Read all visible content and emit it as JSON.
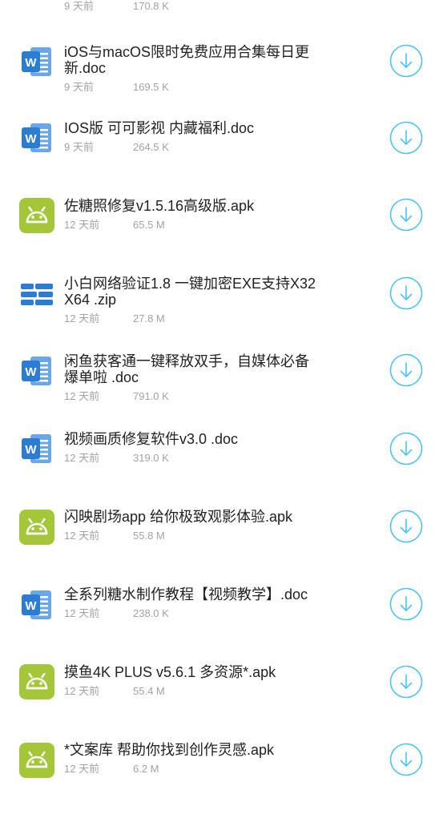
{
  "colors": {
    "title_text": "#222222",
    "meta_text": "#a3a3a3",
    "download_accent": "#4cc3f3",
    "word_icon": "#2b7cd3",
    "android_icon": "#a4c639",
    "compressed_icon": "#2b7cd3"
  },
  "partial_top": {
    "date": "9 天前",
    "size": "170.8 K"
  },
  "files": [
    {
      "icon": "word-icon",
      "title": "iOS与macOS限时免费应用合集每日更新.doc",
      "date": "9 天前",
      "size": "169.5 K"
    },
    {
      "icon": "word-icon",
      "title": "IOS版 可可影视 内藏福利.doc",
      "date": "9 天前",
      "size": "264.5 K"
    },
    {
      "icon": "android-icon",
      "title": "佐糖照修复v1.5.16高级版.apk",
      "date": "12 天前",
      "size": "65.5 M"
    },
    {
      "icon": "archive-icon",
      "title": "小白网络验证1.8 一键加密EXE支持X32 X64 .zip",
      "date": "12 天前",
      "size": "27.8 M"
    },
    {
      "icon": "word-icon",
      "title": "闲鱼获客通一键释放双手，自媒体必备 爆单啦 .doc",
      "date": "12 天前",
      "size": "791.0 K"
    },
    {
      "icon": "word-icon",
      "title": "视频画质修复软件v3.0 .doc",
      "date": "12 天前",
      "size": "319.0 K"
    },
    {
      "icon": "android-icon",
      "title": "闪映剧场app 给你极致观影体验.apk",
      "date": "12 天前",
      "size": "55.8 M"
    },
    {
      "icon": "word-icon",
      "title": "全系列糖水制作教程【视频教学】.doc",
      "date": "12 天前",
      "size": "238.0 K"
    },
    {
      "icon": "android-icon",
      "title": "摸鱼4K PLUS v5.6.1 多资源*.apk",
      "date": "12 天前",
      "size": "55.4 M"
    },
    {
      "icon": "android-icon",
      "title": "*文案库 帮助你找到创作灵感.apk",
      "date": "12 天前",
      "size": "6.2 M"
    }
  ]
}
